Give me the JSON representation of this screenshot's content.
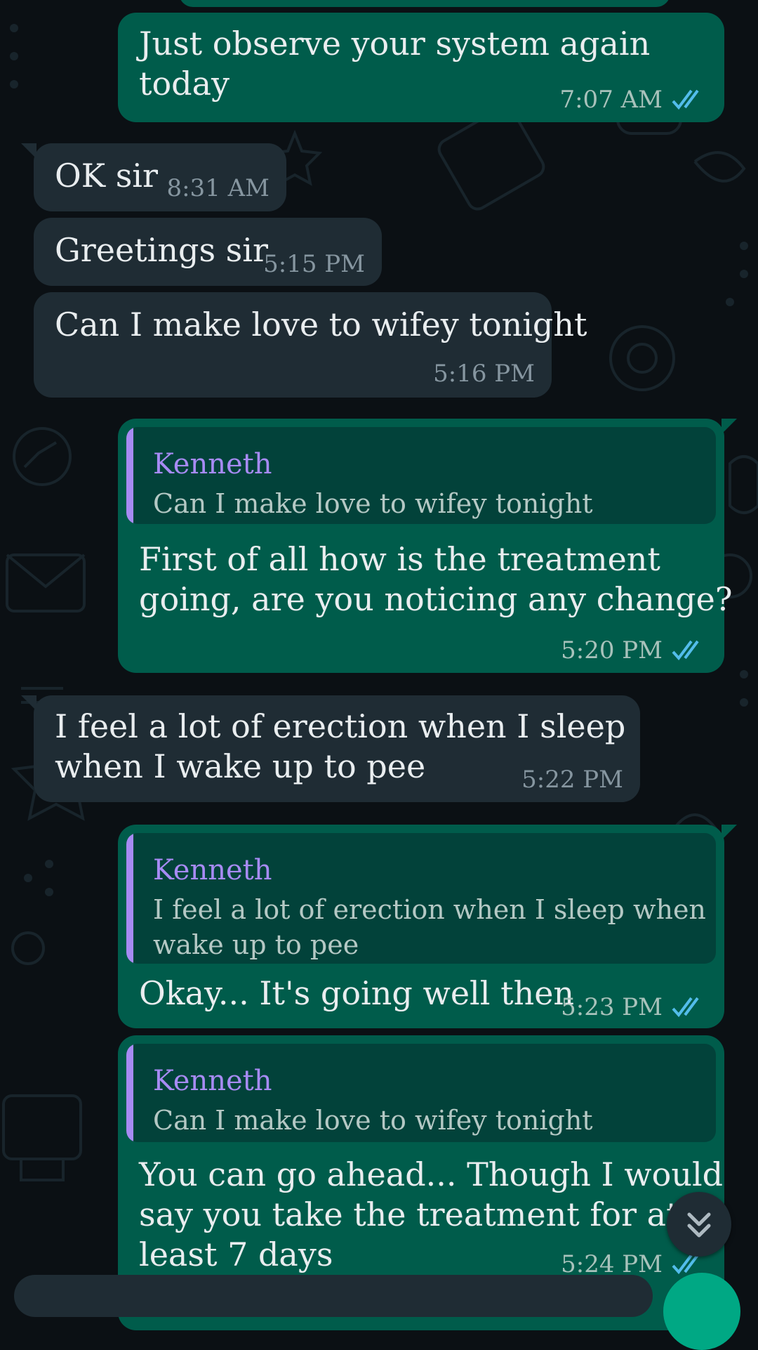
{
  "colors": {
    "background": "#0b1014",
    "outgoing_bubble": "#005c4b",
    "incoming_bubble": "#1f2c34",
    "quote_bubble": "#02423a",
    "quote_accent": "#a78bf4",
    "read_ticks": "#53bdeb"
  },
  "icons": [
    "double-check-icon",
    "chevron-double-down-icon"
  ],
  "messages": [
    {
      "direction": "outgoing",
      "text": "Just observe your system again\ntoday",
      "time": "7:07 AM",
      "status": "read"
    },
    {
      "direction": "incoming",
      "text": "OK sir",
      "time": "8:31 AM"
    },
    {
      "direction": "incoming",
      "text": "Greetings sir",
      "time": "5:15 PM"
    },
    {
      "direction": "incoming",
      "text": "Can I make love to wifey tonight",
      "time": "5:16 PM"
    },
    {
      "direction": "outgoing",
      "quote": {
        "author": "Kenneth",
        "text": "Can I make love to wifey tonight"
      },
      "text": "First of all how is the treatment\ngoing, are you noticing any change?",
      "time": "5:20 PM",
      "status": "read"
    },
    {
      "direction": "incoming",
      "text": "I feel a lot of erection when I sleep\nwhen I wake up to pee",
      "time": "5:22 PM"
    },
    {
      "direction": "outgoing",
      "quote": {
        "author": "Kenneth",
        "text": "I feel a lot of erection when I sleep when I\nwake up to pee"
      },
      "text": "Okay... It's going well then",
      "time": "5:23 PM",
      "status": "read"
    },
    {
      "direction": "outgoing",
      "quote": {
        "author": "Kenneth",
        "text": "Can I make love to wifey tonight"
      },
      "text": "You can go ahead... Though I would\nsay you take the treatment for at\nleast 7 days",
      "time": "5:24 PM",
      "status": "read"
    }
  ]
}
